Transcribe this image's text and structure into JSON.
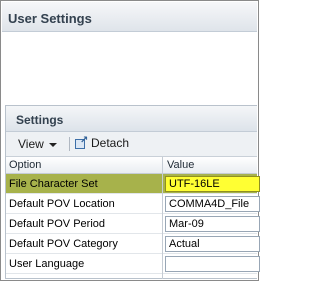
{
  "outer": {
    "title": "User Settings"
  },
  "panel": {
    "title": "Settings"
  },
  "toolbar": {
    "view_label": "View",
    "detach_label": "Detach"
  },
  "grid": {
    "columns": [
      "Option",
      "Value"
    ],
    "rows": [
      {
        "option": "File Character Set",
        "value": "UTF-16LE",
        "selected": true
      },
      {
        "option": "Default POV Location",
        "value": "COMMA4D_File",
        "selected": false
      },
      {
        "option": "Default POV Period",
        "value": "Mar-09",
        "selected": false
      },
      {
        "option": "Default POV Category",
        "value": "Actual",
        "selected": false
      },
      {
        "option": "User Language",
        "value": "",
        "selected": false
      }
    ]
  },
  "colors": {
    "selected_row": "#a7b24b",
    "selected_value": "#ffff33",
    "title_text": "#33414f"
  }
}
